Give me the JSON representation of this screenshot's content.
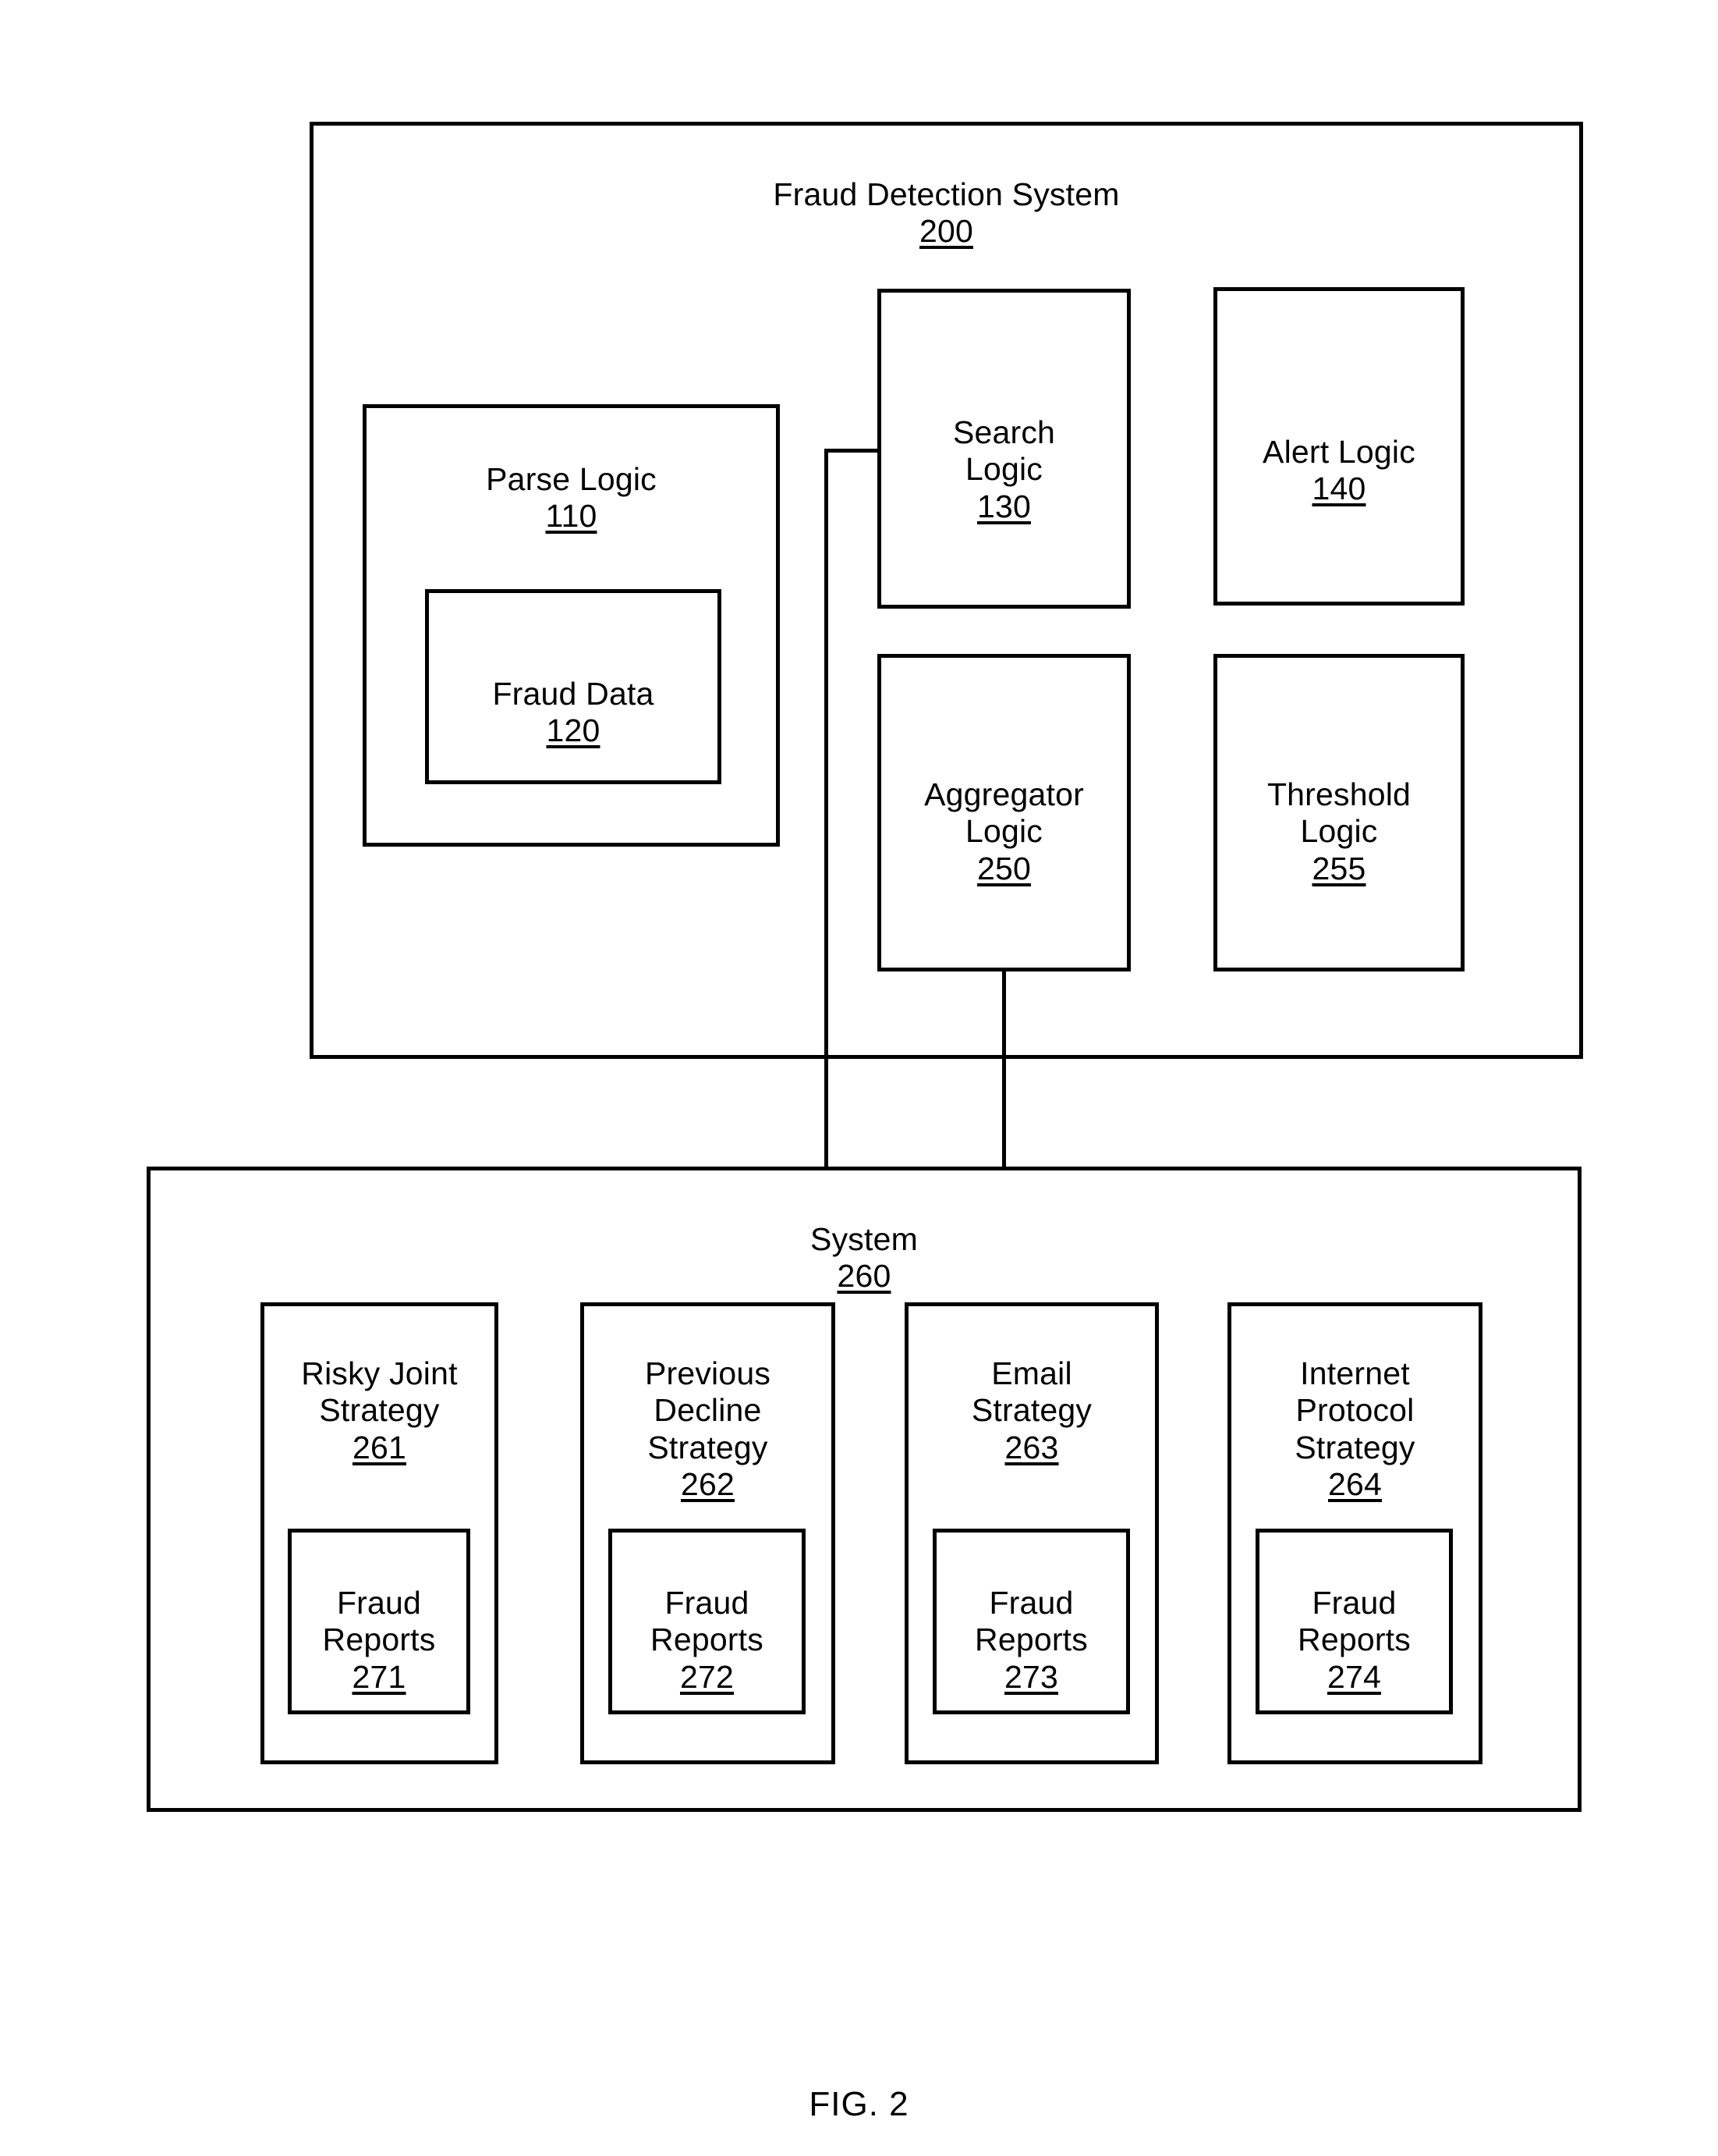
{
  "figure": {
    "caption": "FIG. 2"
  },
  "fraud_detection_system": {
    "title": "Fraud Detection System",
    "ref": "200",
    "components": [
      {
        "id": "parse-logic",
        "title": "Parse Logic",
        "ref": "110",
        "child": {
          "id": "fraud-data",
          "title": "Fraud Data",
          "ref": "120"
        }
      },
      {
        "id": "search-logic",
        "title": "Search\nLogic",
        "ref": "130"
      },
      {
        "id": "alert-logic",
        "title": "Alert Logic",
        "ref": "140"
      },
      {
        "id": "aggregator-logic",
        "title": "Aggregator\nLogic",
        "ref": "250"
      },
      {
        "id": "threshold-logic",
        "title": "Threshold\nLogic",
        "ref": "255"
      }
    ]
  },
  "system": {
    "title": "System",
    "ref": "260",
    "strategies": [
      {
        "id": "risky-joint-strategy",
        "title": "Risky Joint\nStrategy",
        "ref": "261",
        "child": {
          "id": "fraud-reports-271",
          "title": "Fraud\nReports",
          "ref": "271"
        }
      },
      {
        "id": "previous-decline-strategy",
        "title": "Previous\nDecline\nStrategy",
        "ref": "262",
        "child": {
          "id": "fraud-reports-272",
          "title": "Fraud\nReports",
          "ref": "272"
        }
      },
      {
        "id": "email-strategy",
        "title": "Email\nStrategy",
        "ref": "263",
        "child": {
          "id": "fraud-reports-273",
          "title": "Fraud\nReports",
          "ref": "273"
        }
      },
      {
        "id": "internet-protocol-strategy",
        "title": "Internet\nProtocol\nStrategy",
        "ref": "264",
        "child": {
          "id": "fraud-reports-274",
          "title": "Fraud\nReports",
          "ref": "274"
        }
      }
    ]
  },
  "colors": {
    "stroke": "#000000",
    "background": "#ffffff"
  }
}
